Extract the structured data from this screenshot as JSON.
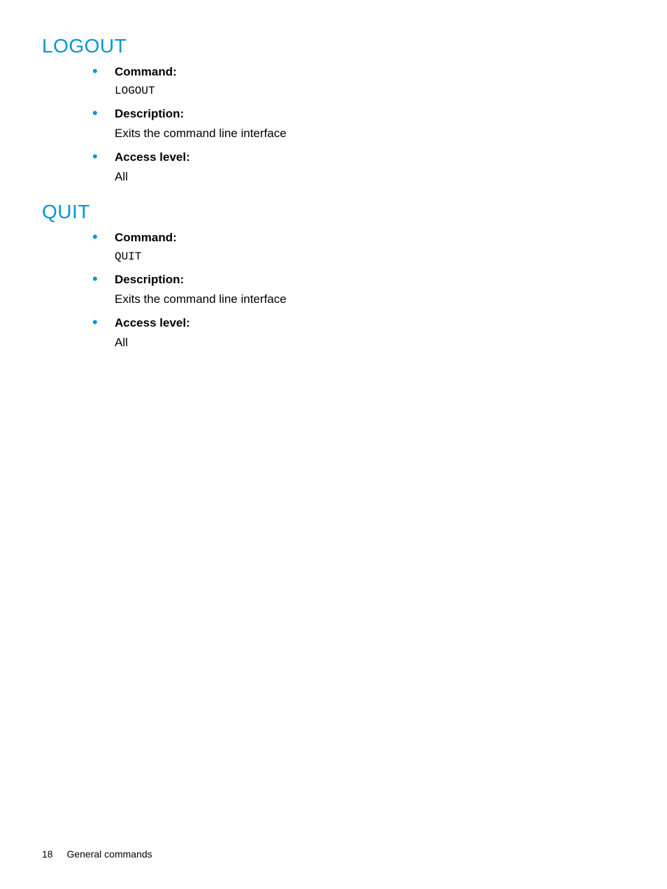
{
  "sections": [
    {
      "heading": "LOGOUT",
      "items": [
        {
          "label": "Command:",
          "value": "LOGOUT",
          "mono": true
        },
        {
          "label": "Description:",
          "value": "Exits the command line interface",
          "mono": false
        },
        {
          "label": "Access level:",
          "value": "All",
          "mono": false
        }
      ]
    },
    {
      "heading": "QUIT",
      "items": [
        {
          "label": "Command:",
          "value": "QUIT",
          "mono": true
        },
        {
          "label": "Description:",
          "value": "Exits the command line interface",
          "mono": false
        },
        {
          "label": "Access level:",
          "value": "All",
          "mono": false
        }
      ]
    }
  ],
  "footer": {
    "page_number": "18",
    "chapter": "General commands"
  }
}
